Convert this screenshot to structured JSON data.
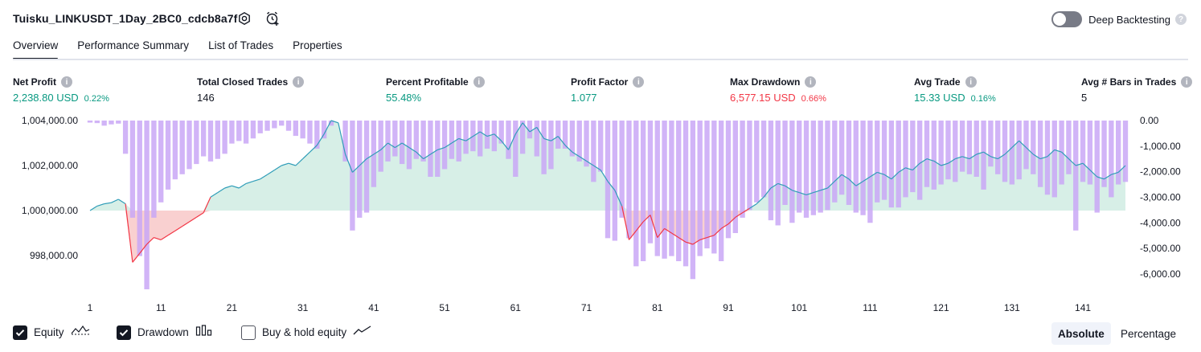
{
  "header": {
    "title": "Tuisku_LINKUSDT_1Day_2BC0_cdcb8a7f",
    "deep_backtesting_label": "Deep Backtesting",
    "deep_backtesting_enabled": false
  },
  "tabs": [
    {
      "label": "Overview",
      "active": true
    },
    {
      "label": "Performance Summary",
      "active": false
    },
    {
      "label": "List of Trades",
      "active": false
    },
    {
      "label": "Properties",
      "active": false
    }
  ],
  "metrics": {
    "net_profit": {
      "label": "Net Profit",
      "value": "2,238.80 USD",
      "pct": "0.22%"
    },
    "total_closed_trades": {
      "label": "Total Closed Trades",
      "value": "146"
    },
    "percent_profitable": {
      "label": "Percent Profitable",
      "value": "55.48%"
    },
    "profit_factor": {
      "label": "Profit Factor",
      "value": "1.077"
    },
    "max_drawdown": {
      "label": "Max Drawdown",
      "value": "6,577.15 USD",
      "pct": "0.66%"
    },
    "avg_trade": {
      "label": "Avg Trade",
      "value": "15.33 USD",
      "pct": "0.16%"
    },
    "avg_bars": {
      "label": "Avg # Bars in Trades",
      "value": "5"
    }
  },
  "chart_data": {
    "type": "line",
    "left_axis": {
      "ticks": [
        1004000,
        1002000,
        1000000,
        998000
      ],
      "tick_labels": [
        "1,004,000.00",
        "1,002,000.00",
        "1,000,000.00",
        "998,000.00"
      ]
    },
    "right_axis": {
      "ticks": [
        0,
        -1000,
        -2000,
        -3000,
        -4000,
        -5000,
        -6000
      ],
      "tick_labels": [
        "0.00",
        "-1,000.00",
        "-2,000.00",
        "-3,000.00",
        "-4,000.00",
        "-5,000.00",
        "-6,000.00"
      ]
    },
    "x_ticks": [
      1,
      11,
      21,
      31,
      41,
      51,
      61,
      71,
      81,
      91,
      101,
      111,
      121,
      131,
      141
    ],
    "x": [
      1,
      2,
      3,
      4,
      5,
      6,
      7,
      8,
      9,
      10,
      11,
      12,
      13,
      14,
      15,
      16,
      17,
      18,
      19,
      20,
      21,
      22,
      23,
      24,
      25,
      26,
      27,
      28,
      29,
      30,
      31,
      32,
      33,
      34,
      35,
      36,
      37,
      38,
      39,
      40,
      41,
      42,
      43,
      44,
      45,
      46,
      47,
      48,
      49,
      50,
      51,
      52,
      53,
      54,
      55,
      56,
      57,
      58,
      59,
      60,
      61,
      62,
      63,
      64,
      65,
      66,
      67,
      68,
      69,
      70,
      71,
      72,
      73,
      74,
      75,
      76,
      77,
      78,
      79,
      80,
      81,
      82,
      83,
      84,
      85,
      86,
      87,
      88,
      89,
      90,
      91,
      92,
      93,
      94,
      95,
      96,
      97,
      98,
      99,
      100,
      101,
      102,
      103,
      104,
      105,
      106,
      107,
      108,
      109,
      110,
      111,
      112,
      113,
      114,
      115,
      116,
      117,
      118,
      119,
      120,
      121,
      122,
      123,
      124,
      125,
      126,
      127,
      128,
      129,
      130,
      131,
      132,
      133,
      134,
      135,
      136,
      137,
      138,
      139,
      140,
      141,
      142,
      143,
      144,
      145,
      146,
      147
    ],
    "series": [
      {
        "type": "line",
        "baseline": 1000000,
        "values": [
          1000000,
          1000200,
          1000300,
          1000350,
          1000500,
          1000300,
          997700,
          998100,
          998500,
          998800,
          998700,
          998900,
          999100,
          999300,
          999500,
          999700,
          999900,
          1000600,
          1000800,
          1001000,
          1001100,
          1001000,
          1001200,
          1001300,
          1001400,
          1001600,
          1001800,
          1002000,
          1002100,
          1002000,
          1002300,
          1002600,
          1002900,
          1003400,
          1004000,
          1003900,
          1002500,
          1001700,
          1002000,
          1002300,
          1002500,
          1002700,
          1003000,
          1002800,
          1003000,
          1002800,
          1002600,
          1002300,
          1002500,
          1002700,
          1002800,
          1003000,
          1003200,
          1003100,
          1003300,
          1003500,
          1003300,
          1003400,
          1003100,
          1002700,
          1003400,
          1003900,
          1003500,
          1003700,
          1003200,
          1003100,
          1003300,
          1002900,
          1002600,
          1002400,
          1002200,
          1002000,
          1001800,
          1001300,
          1000900,
          1000200,
          998700,
          999100,
          999500,
          999800,
          998800,
          999200,
          999000,
          998800,
          998600,
          998500,
          998700,
          998800,
          998900,
          999200,
          999400,
          999700,
          999900,
          1000100,
          1000300,
          1000600,
          1001000,
          1001200,
          1001100,
          1000900,
          1000800,
          1000700,
          1000800,
          1000900,
          1001000,
          1001300,
          1001600,
          1001400,
          1001100,
          1001300,
          1001500,
          1001700,
          1001600,
          1001400,
          1001700,
          1001900,
          1001800,
          1002100,
          1002300,
          1002200,
          1002000,
          1002100,
          1002300,
          1002400,
          1002300,
          1002500,
          1002600,
          1002400,
          1002300,
          1002500,
          1002800,
          1003100,
          1002800,
          1002500,
          1002300,
          1002400,
          1002700,
          1002600,
          1002300,
          1002000,
          1002100,
          1001800,
          1001500,
          1001400,
          1001600,
          1001700,
          1002000
        ]
      },
      {
        "type": "bar",
        "values": [
          -80,
          -100,
          -200,
          -150,
          -120,
          -1300,
          -3800,
          -5300,
          -6600,
          -3800,
          -3200,
          -2700,
          -2300,
          -2100,
          -1900,
          -1700,
          -1400,
          -1600,
          -1500,
          -1300,
          -900,
          -800,
          -900,
          -700,
          -500,
          -400,
          -300,
          -200,
          -400,
          -600,
          -700,
          -900,
          -1100,
          -700,
          -200,
          0,
          -1600,
          -4300,
          -3800,
          -3600,
          -2600,
          -2000,
          -1600,
          -1400,
          -1700,
          -1900,
          -1500,
          -1600,
          -2200,
          -2200,
          -1900,
          -1500,
          -1600,
          -1300,
          -1200,
          -1400,
          -1100,
          -1200,
          -900,
          -1500,
          -2200,
          -1300,
          -700,
          -1400,
          -2100,
          -1900,
          -1100,
          -1100,
          -1400,
          -1600,
          -1800,
          -2400,
          -2000,
          -4600,
          -4700,
          -3800,
          -4600,
          -5700,
          -5500,
          -4800,
          -5300,
          -5400,
          -5300,
          -5500,
          -5700,
          -6200,
          -5300,
          -5000,
          -5200,
          -5500,
          -4600,
          -4400,
          -3800,
          -3500,
          -3200,
          -3000,
          -3900,
          -4100,
          -3300,
          -4000,
          -3600,
          -3800,
          -3700,
          -3600,
          -3500,
          -3200,
          -2900,
          -3300,
          -3600,
          -3700,
          -4000,
          -3200,
          -3100,
          -3400,
          -3400,
          -3000,
          -2800,
          -3100,
          -2600,
          -2700,
          -2500,
          -2300,
          -2400,
          -2000,
          -2100,
          -2200,
          -2700,
          -1800,
          -2100,
          -2400,
          -2500,
          -2300,
          -1900,
          -2100,
          -2600,
          -2900,
          -3000,
          -2500,
          -2100,
          -4300,
          -2400,
          -2500,
          -3600,
          -2600,
          -3000,
          -2500,
          -2400
        ]
      }
    ],
    "colors": {
      "equity_line": "#2f9db8",
      "drawdown_line": "#f23645",
      "drawdown_bars": "#c9a7f6",
      "equity_fill": "#d7efe7",
      "loss_fill": "#f9d0d0"
    }
  },
  "legend": {
    "equity": {
      "label": "Equity",
      "checked": true
    },
    "drawdown": {
      "label": "Drawdown",
      "checked": true
    },
    "buy_hold": {
      "label": "Buy & hold equity",
      "checked": false
    }
  },
  "view_toggle": {
    "absolute": "Absolute",
    "percentage": "Percentage",
    "selected": "Absolute"
  }
}
